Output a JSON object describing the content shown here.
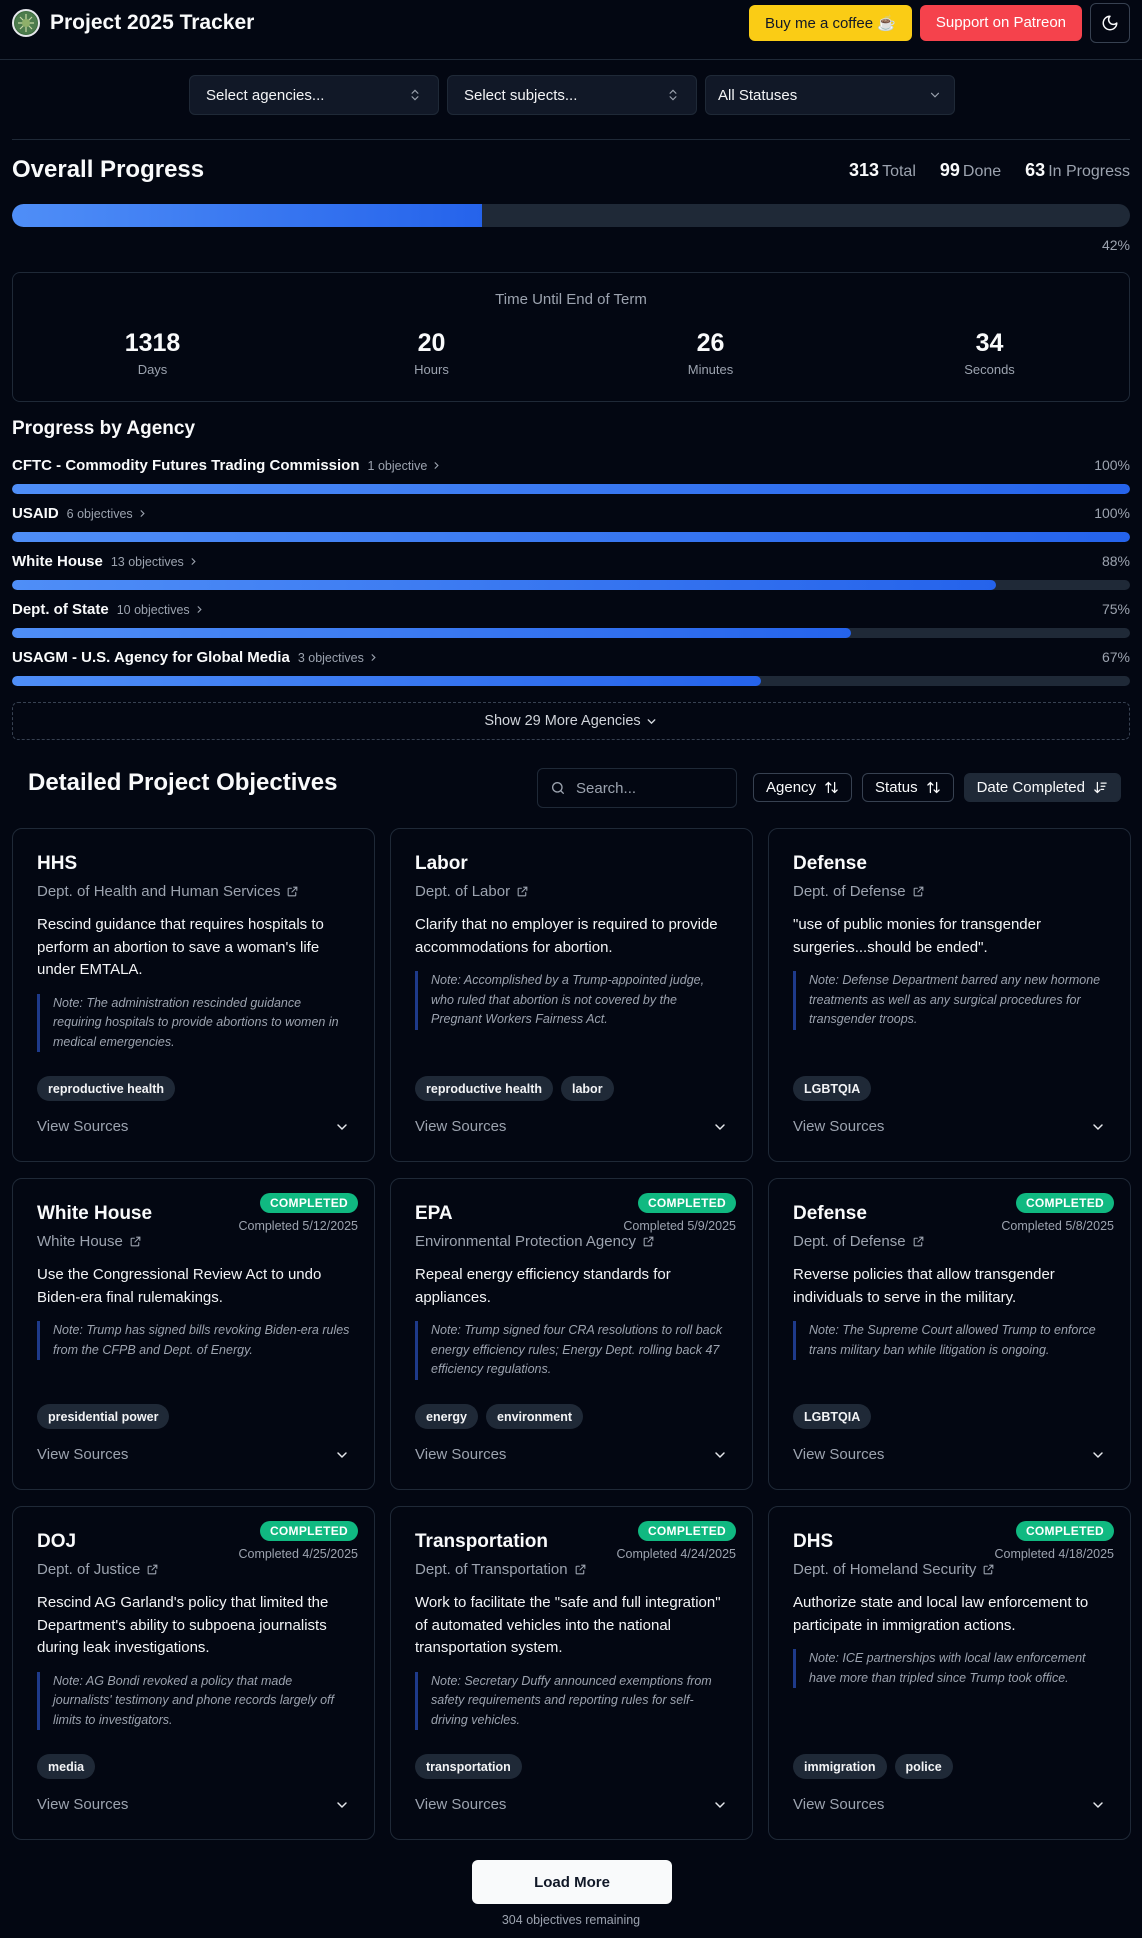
{
  "header": {
    "title": "Project 2025 Tracker",
    "coffee_label": "Buy me a coffee ☕",
    "patreon_label": "Support on Patreon"
  },
  "filters": {
    "agencies": "Select agencies...",
    "subjects": "Select subjects...",
    "status": "All Statuses"
  },
  "overall": {
    "title": "Overall Progress",
    "total": "313",
    "total_label": "Total",
    "done": "99",
    "done_label": "Done",
    "in_progress": "63",
    "in_progress_label": "In Progress",
    "percent_value": 42,
    "percent_text": "42%"
  },
  "timer": {
    "title": "Time Until End of Term",
    "units": [
      {
        "value": "1318",
        "label": "Days"
      },
      {
        "value": "20",
        "label": "Hours"
      },
      {
        "value": "26",
        "label": "Minutes"
      },
      {
        "value": "34",
        "label": "Seconds"
      }
    ]
  },
  "agency_progress": {
    "title": "Progress by Agency",
    "rows": [
      {
        "name": "CFTC - Commodity Futures Trading Commission",
        "count": "1 objective",
        "percent": 100,
        "percent_text": "100%"
      },
      {
        "name": "USAID",
        "count": "6 objectives",
        "percent": 100,
        "percent_text": "100%"
      },
      {
        "name": "White House",
        "count": "13 objectives",
        "percent": 88,
        "percent_text": "88%"
      },
      {
        "name": "Dept. of State",
        "count": "10 objectives",
        "percent": 75,
        "percent_text": "75%"
      },
      {
        "name": "USAGM - U.S. Agency for Global Media",
        "count": "3 objectives",
        "percent": 67,
        "percent_text": "67%"
      }
    ],
    "show_more": "Show 29 More Agencies"
  },
  "objectives": {
    "title": "Detailed Project Objectives",
    "search_placeholder": "Search...",
    "sort": {
      "agency": "Agency",
      "status": "Status",
      "date": "Date Completed"
    },
    "view_sources": "View Sources",
    "cards": [
      {
        "agency": "HHS",
        "dept": "Dept. of Health and Human Services",
        "title": "Rescind guidance that requires hospitals to perform an abortion to save a woman's life under EMTALA.",
        "note": "Note: The administration rescinded guidance requiring hospitals to provide abortions to women in medical emergencies.",
        "tags": [
          "reproductive health"
        ],
        "badge": "",
        "date": ""
      },
      {
        "agency": "Labor",
        "dept": "Dept. of Labor",
        "title": "Clarify that no employer is required to provide accommodations for abortion.",
        "note": "Note: Accomplished by a Trump-appointed judge, who ruled that abortion is not covered by the Pregnant Workers Fairness Act.",
        "tags": [
          "reproductive health",
          "labor"
        ],
        "badge": "",
        "date": ""
      },
      {
        "agency": "Defense",
        "dept": "Dept. of Defense",
        "title": "\"use of public monies for transgender surgeries...should be ended\".",
        "note": "Note: Defense Department barred any new hormone treatments as well as any surgical procedures for transgender troops.",
        "tags": [
          "LGBTQIA"
        ],
        "badge": "",
        "date": ""
      },
      {
        "agency": "White House",
        "dept": "White House",
        "title": "Use the Congressional Review Act to undo Biden-era final rulemakings.",
        "note": "Note: Trump has signed bills revoking Biden-era rules from the CFPB and Dept. of Energy.",
        "tags": [
          "presidential power"
        ],
        "badge": "COMPLETED",
        "date": "Completed 5/12/2025"
      },
      {
        "agency": "EPA",
        "dept": "Environmental Protection Agency",
        "title": "Repeal energy efficiency standards for appliances.",
        "note": "Note: Trump signed four CRA resolutions to roll back energy efficiency rules; Energy Dept. rolling back 47 efficiency regulations.",
        "tags": [
          "energy",
          "environment"
        ],
        "badge": "COMPLETED",
        "date": "Completed 5/9/2025"
      },
      {
        "agency": "Defense",
        "dept": "Dept. of Defense",
        "title": "Reverse policies that allow transgender individuals to serve in the military.",
        "note": "Note: The Supreme Court allowed Trump to enforce trans military ban while litigation is ongoing.",
        "tags": [
          "LGBTQIA"
        ],
        "badge": "COMPLETED",
        "date": "Completed 5/8/2025"
      },
      {
        "agency": "DOJ",
        "dept": "Dept. of Justice",
        "title": "Rescind AG Garland's policy that limited the Department's ability to subpoena journalists during leak investigations.",
        "note": "Note: AG Bondi revoked a policy that made journalists' testimony and phone records largely off limits to investigators.",
        "tags": [
          "media"
        ],
        "badge": "COMPLETED",
        "date": "Completed 4/25/2025"
      },
      {
        "agency": "Transportation",
        "dept": "Dept. of Transportation",
        "title": "Work to facilitate the \"safe and full integration\" of automated vehicles into the national transportation system.",
        "note": "Note: Secretary Duffy announced exemptions from safety requirements and reporting rules for self-driving vehicles.",
        "tags": [
          "transportation"
        ],
        "badge": "COMPLETED",
        "date": "Completed 4/24/2025"
      },
      {
        "agency": "DHS",
        "dept": "Dept. of Homeland Security",
        "title": "Authorize state and local law enforcement to participate in immigration actions.",
        "note": "Note: ICE partnerships with local law enforcement have more than tripled since Trump took office.",
        "tags": [
          "immigration",
          "police"
        ],
        "badge": "COMPLETED",
        "date": "Completed 4/18/2025"
      }
    ],
    "load_more": "Load More",
    "remaining": "304 objectives remaining"
  },
  "colors": {
    "background": "#030712",
    "accent_blue": "#2563eb",
    "completed_green": "#10b981",
    "coffee_yellow": "#facc15",
    "patreon_red": "#f5424c"
  },
  "icons": [
    "logo-icon",
    "moon-icon",
    "chevron-updown-icon",
    "chevron-down-icon",
    "chevron-right-icon",
    "search-icon",
    "sort-icon",
    "external-link-icon"
  ]
}
